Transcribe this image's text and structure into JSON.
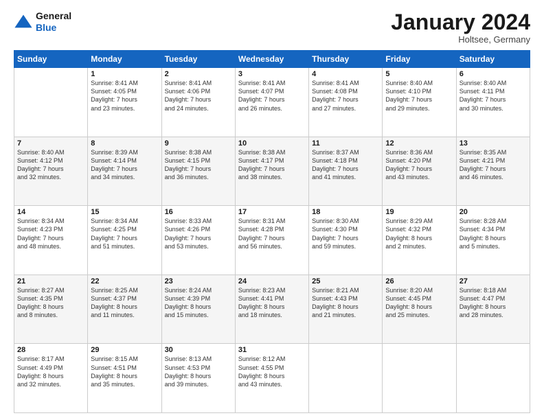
{
  "header": {
    "logo_line1": "General",
    "logo_line2": "Blue",
    "month_title": "January 2024",
    "subtitle": "Holtsee, Germany"
  },
  "weekdays": [
    "Sunday",
    "Monday",
    "Tuesday",
    "Wednesday",
    "Thursday",
    "Friday",
    "Saturday"
  ],
  "weeks": [
    [
      {
        "day": "",
        "info": ""
      },
      {
        "day": "1",
        "info": "Sunrise: 8:41 AM\nSunset: 4:05 PM\nDaylight: 7 hours\nand 23 minutes."
      },
      {
        "day": "2",
        "info": "Sunrise: 8:41 AM\nSunset: 4:06 PM\nDaylight: 7 hours\nand 24 minutes."
      },
      {
        "day": "3",
        "info": "Sunrise: 8:41 AM\nSunset: 4:07 PM\nDaylight: 7 hours\nand 26 minutes."
      },
      {
        "day": "4",
        "info": "Sunrise: 8:41 AM\nSunset: 4:08 PM\nDaylight: 7 hours\nand 27 minutes."
      },
      {
        "day": "5",
        "info": "Sunrise: 8:40 AM\nSunset: 4:10 PM\nDaylight: 7 hours\nand 29 minutes."
      },
      {
        "day": "6",
        "info": "Sunrise: 8:40 AM\nSunset: 4:11 PM\nDaylight: 7 hours\nand 30 minutes."
      }
    ],
    [
      {
        "day": "7",
        "info": "Sunrise: 8:40 AM\nSunset: 4:12 PM\nDaylight: 7 hours\nand 32 minutes."
      },
      {
        "day": "8",
        "info": "Sunrise: 8:39 AM\nSunset: 4:14 PM\nDaylight: 7 hours\nand 34 minutes."
      },
      {
        "day": "9",
        "info": "Sunrise: 8:38 AM\nSunset: 4:15 PM\nDaylight: 7 hours\nand 36 minutes."
      },
      {
        "day": "10",
        "info": "Sunrise: 8:38 AM\nSunset: 4:17 PM\nDaylight: 7 hours\nand 38 minutes."
      },
      {
        "day": "11",
        "info": "Sunrise: 8:37 AM\nSunset: 4:18 PM\nDaylight: 7 hours\nand 41 minutes."
      },
      {
        "day": "12",
        "info": "Sunrise: 8:36 AM\nSunset: 4:20 PM\nDaylight: 7 hours\nand 43 minutes."
      },
      {
        "day": "13",
        "info": "Sunrise: 8:35 AM\nSunset: 4:21 PM\nDaylight: 7 hours\nand 46 minutes."
      }
    ],
    [
      {
        "day": "14",
        "info": "Sunrise: 8:34 AM\nSunset: 4:23 PM\nDaylight: 7 hours\nand 48 minutes."
      },
      {
        "day": "15",
        "info": "Sunrise: 8:34 AM\nSunset: 4:25 PM\nDaylight: 7 hours\nand 51 minutes."
      },
      {
        "day": "16",
        "info": "Sunrise: 8:33 AM\nSunset: 4:26 PM\nDaylight: 7 hours\nand 53 minutes."
      },
      {
        "day": "17",
        "info": "Sunrise: 8:31 AM\nSunset: 4:28 PM\nDaylight: 7 hours\nand 56 minutes."
      },
      {
        "day": "18",
        "info": "Sunrise: 8:30 AM\nSunset: 4:30 PM\nDaylight: 7 hours\nand 59 minutes."
      },
      {
        "day": "19",
        "info": "Sunrise: 8:29 AM\nSunset: 4:32 PM\nDaylight: 8 hours\nand 2 minutes."
      },
      {
        "day": "20",
        "info": "Sunrise: 8:28 AM\nSunset: 4:34 PM\nDaylight: 8 hours\nand 5 minutes."
      }
    ],
    [
      {
        "day": "21",
        "info": "Sunrise: 8:27 AM\nSunset: 4:35 PM\nDaylight: 8 hours\nand 8 minutes."
      },
      {
        "day": "22",
        "info": "Sunrise: 8:25 AM\nSunset: 4:37 PM\nDaylight: 8 hours\nand 11 minutes."
      },
      {
        "day": "23",
        "info": "Sunrise: 8:24 AM\nSunset: 4:39 PM\nDaylight: 8 hours\nand 15 minutes."
      },
      {
        "day": "24",
        "info": "Sunrise: 8:23 AM\nSunset: 4:41 PM\nDaylight: 8 hours\nand 18 minutes."
      },
      {
        "day": "25",
        "info": "Sunrise: 8:21 AM\nSunset: 4:43 PM\nDaylight: 8 hours\nand 21 minutes."
      },
      {
        "day": "26",
        "info": "Sunrise: 8:20 AM\nSunset: 4:45 PM\nDaylight: 8 hours\nand 25 minutes."
      },
      {
        "day": "27",
        "info": "Sunrise: 8:18 AM\nSunset: 4:47 PM\nDaylight: 8 hours\nand 28 minutes."
      }
    ],
    [
      {
        "day": "28",
        "info": "Sunrise: 8:17 AM\nSunset: 4:49 PM\nDaylight: 8 hours\nand 32 minutes."
      },
      {
        "day": "29",
        "info": "Sunrise: 8:15 AM\nSunset: 4:51 PM\nDaylight: 8 hours\nand 35 minutes."
      },
      {
        "day": "30",
        "info": "Sunrise: 8:13 AM\nSunset: 4:53 PM\nDaylight: 8 hours\nand 39 minutes."
      },
      {
        "day": "31",
        "info": "Sunrise: 8:12 AM\nSunset: 4:55 PM\nDaylight: 8 hours\nand 43 minutes."
      },
      {
        "day": "",
        "info": ""
      },
      {
        "day": "",
        "info": ""
      },
      {
        "day": "",
        "info": ""
      }
    ]
  ]
}
